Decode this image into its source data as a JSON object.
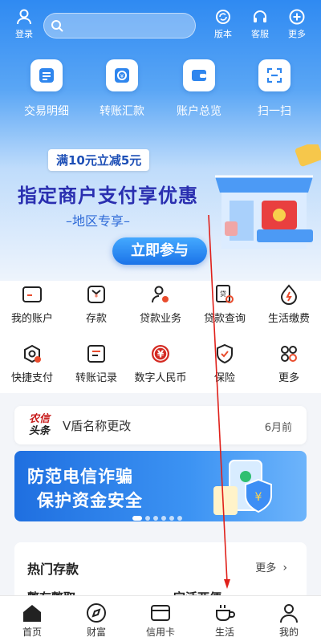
{
  "top_bar": {
    "login": "登录",
    "version": "版本",
    "service": "客服",
    "more": "更多",
    "search_placeholder": ""
  },
  "quick_actions": [
    {
      "label": "交易明细",
      "icon": "list-icon"
    },
    {
      "label": "转账汇款",
      "icon": "transfer-icon"
    },
    {
      "label": "账户总览",
      "icon": "wallet-icon"
    },
    {
      "label": "扫一扫",
      "icon": "scan-icon"
    }
  ],
  "banner": {
    "badge": "满10元立减5元",
    "title": "指定商户支付享优惠",
    "subtitle": "–地区专享–",
    "button": "立即参与"
  },
  "services": [
    {
      "label": "我的账户",
      "icon": "card-icon"
    },
    {
      "label": "存款",
      "icon": "deposit-icon"
    },
    {
      "label": "贷款业务",
      "icon": "loan-user-icon"
    },
    {
      "label": "贷款查询",
      "icon": "loan-query-icon"
    },
    {
      "label": "生活缴费",
      "icon": "bill-icon"
    },
    {
      "label": "快捷支付",
      "icon": "quick-pay-icon"
    },
    {
      "label": "转账记录",
      "icon": "record-icon"
    },
    {
      "label": "数字人民币",
      "icon": "digital-rmb-icon"
    },
    {
      "label": "保险",
      "icon": "shield-icon"
    },
    {
      "label": "更多",
      "icon": "grid-more-icon"
    }
  ],
  "news": {
    "logo_line1": "农信",
    "logo_line2": "头条",
    "text": "V盾名称更改",
    "time": "6月前"
  },
  "fraud_banner": {
    "line1": "防范电信诈骗",
    "line2": "保护资金安全"
  },
  "hot_deposits": {
    "title": "热门存款",
    "more": "更多",
    "item_a": "整存整取",
    "item_b": "定活两便"
  },
  "tabs": [
    {
      "label": "首页",
      "active": true
    },
    {
      "label": "财富",
      "active": false
    },
    {
      "label": "信用卡",
      "active": false
    },
    {
      "label": "生活",
      "active": false
    },
    {
      "label": "我的",
      "active": false
    }
  ],
  "colors": {
    "primary": "#2f8af2",
    "banner_title": "#2a2fb0",
    "annotation_arrow": "#e0201a"
  }
}
